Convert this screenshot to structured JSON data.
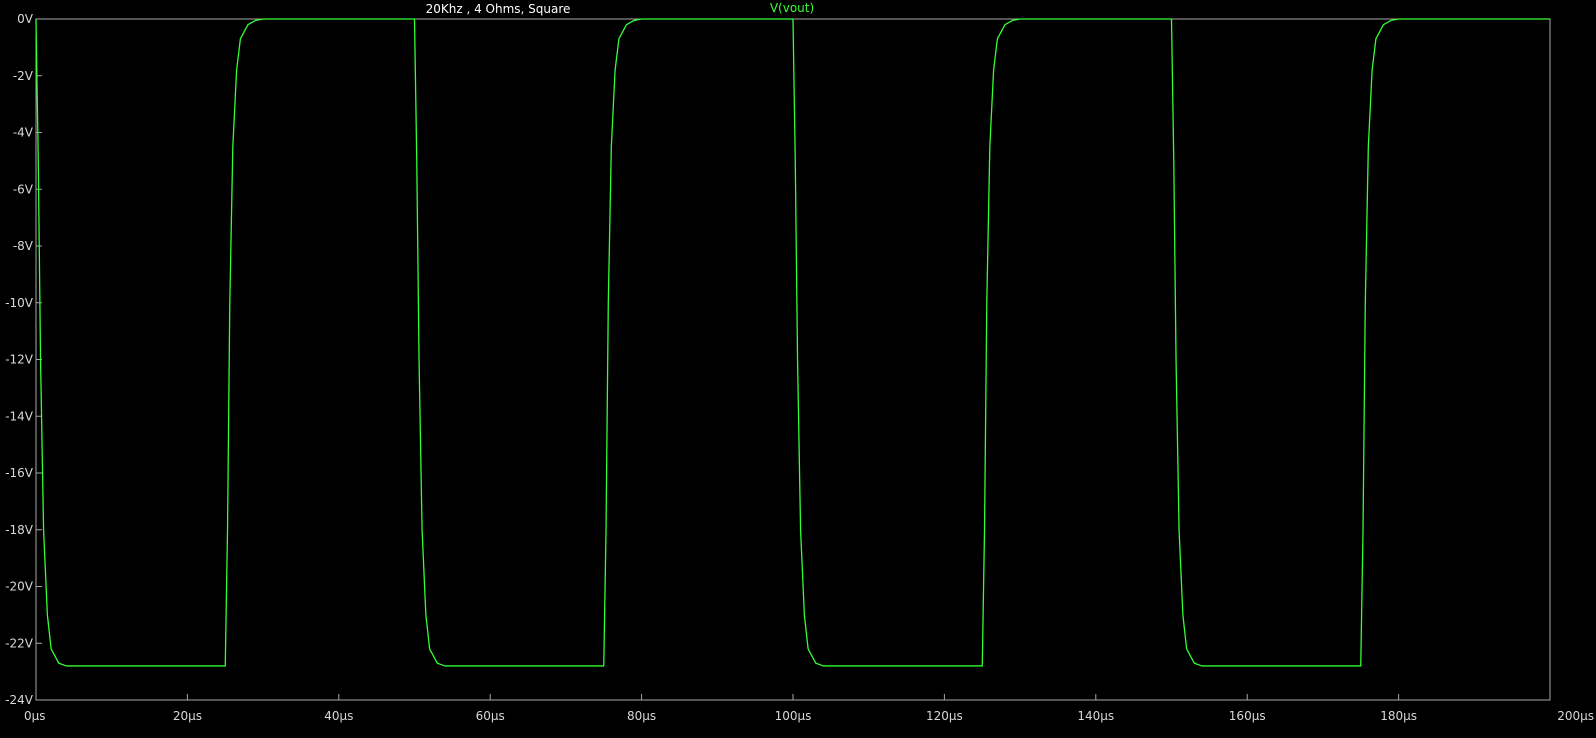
{
  "chart_data": {
    "type": "line",
    "title": "20Khz , 4 Ohms, Square",
    "xlabel": "",
    "ylabel": "",
    "x_unit": "µs",
    "y_unit": "V",
    "xlim": [
      0,
      200
    ],
    "ylim": [
      -24,
      0
    ],
    "x_ticks": [
      0,
      20,
      40,
      60,
      80,
      100,
      120,
      140,
      160,
      180,
      200
    ],
    "y_ticks": [
      0,
      -2,
      -4,
      -6,
      -8,
      -10,
      -12,
      -14,
      -16,
      -18,
      -20,
      -22,
      -24
    ],
    "x_tick_labels": [
      "0µs",
      "20µs",
      "40µs",
      "60µs",
      "80µs",
      "100µs",
      "120µs",
      "140µs",
      "160µs",
      "180µs",
      "200µs"
    ],
    "y_tick_labels": [
      "0V",
      "-2V",
      "-4V",
      "-6V",
      "-8V",
      "-10V",
      "-12V",
      "-14V",
      "-16V",
      "-18V",
      "-20V",
      "-22V",
      "-24V"
    ],
    "grid": false,
    "series": [
      {
        "name": "V(vout)",
        "color": "#33ff33",
        "x": [
          0,
          0.3,
          0.6,
          1.0,
          1.5,
          2.0,
          3.0,
          4.0,
          5.0,
          25.0,
          25.3,
          25.6,
          26.0,
          26.5,
          27.0,
          28.0,
          29.0,
          30.0,
          50.0,
          50.3,
          50.6,
          51.0,
          51.5,
          52.0,
          53.0,
          54.0,
          55.0,
          75.0,
          75.3,
          75.6,
          76.0,
          76.5,
          77.0,
          78.0,
          79.0,
          80.0,
          100.0,
          100.3,
          100.6,
          101.0,
          101.5,
          102.0,
          103.0,
          104.0,
          105.0,
          125.0,
          125.3,
          125.6,
          126.0,
          126.5,
          127.0,
          128.0,
          129.0,
          130.0,
          150.0,
          150.3,
          150.6,
          151.0,
          151.5,
          152.0,
          153.0,
          154.0,
          155.0,
          175.0,
          175.3,
          175.6,
          176.0,
          176.5,
          177.0,
          178.0,
          179.0,
          180.0,
          200.0
        ],
        "y": [
          0,
          -5,
          -12,
          -18,
          -21,
          -22.2,
          -22.7,
          -22.8,
          -22.8,
          -22.8,
          -18,
          -10,
          -4.5,
          -1.8,
          -0.7,
          -0.2,
          -0.05,
          0,
          0,
          -5,
          -12,
          -18,
          -21,
          -22.2,
          -22.7,
          -22.8,
          -22.8,
          -22.8,
          -18,
          -10,
          -4.5,
          -1.8,
          -0.7,
          -0.2,
          -0.05,
          0,
          0,
          -5,
          -12,
          -18,
          -21,
          -22.2,
          -22.7,
          -22.8,
          -22.8,
          -22.8,
          -18,
          -10,
          -4.5,
          -1.8,
          -0.7,
          -0.2,
          -0.05,
          0,
          0,
          -5,
          -12,
          -18,
          -21,
          -22.2,
          -22.7,
          -22.8,
          -22.8,
          -22.8,
          -18,
          -10,
          -4.5,
          -1.8,
          -0.7,
          -0.2,
          -0.05,
          0,
          0
        ]
      }
    ]
  }
}
